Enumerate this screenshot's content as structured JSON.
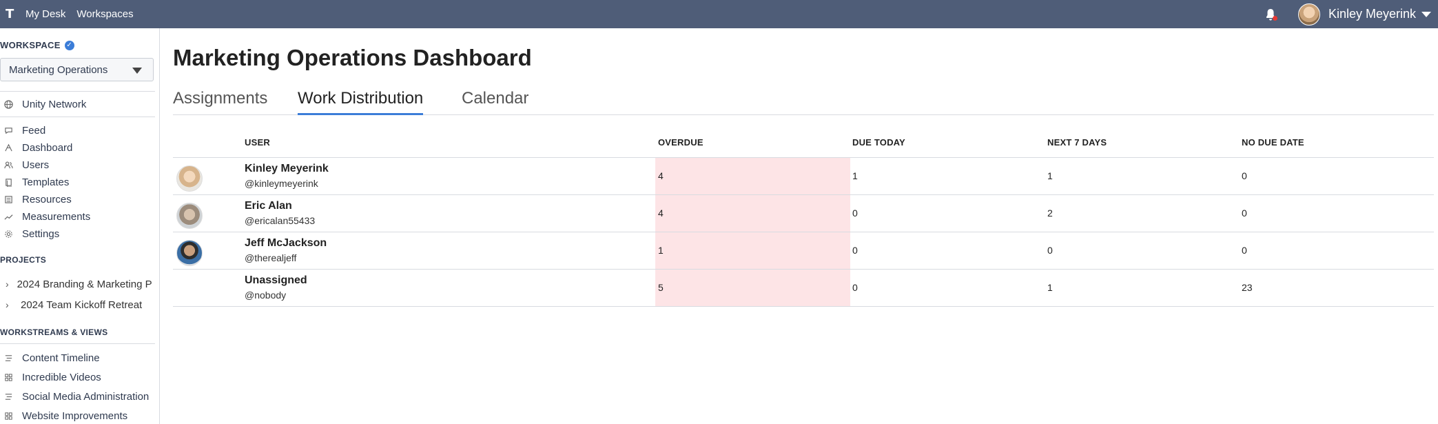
{
  "topbar": {
    "logo": "T",
    "nav": [
      "My Desk",
      "Workspaces"
    ],
    "username": "Kinley Meyerink"
  },
  "sidebar": {
    "workspace_label": "WORKSPACE",
    "workspace_selected": "Marketing Operations",
    "network": "Unity Network",
    "nav": [
      {
        "label": "Feed",
        "icon": "chat-bubble-icon"
      },
      {
        "label": "Dashboard",
        "icon": "dashboard-icon"
      },
      {
        "label": "Users",
        "icon": "users-icon"
      },
      {
        "label": "Templates",
        "icon": "templates-icon"
      },
      {
        "label": "Resources",
        "icon": "resources-icon"
      },
      {
        "label": "Measurements",
        "icon": "trend-icon"
      },
      {
        "label": "Settings",
        "icon": "gear-icon"
      }
    ],
    "projects_label": "PROJECTS",
    "projects": [
      "2024 Branding & Marketing P",
      "2024 Team Kickoff Retreat"
    ],
    "workstreams_label": "WORKSTREAMS & VIEWS",
    "workstreams": [
      {
        "label": "Content Timeline",
        "icon": "timeline-icon"
      },
      {
        "label": "Incredible Videos",
        "icon": "grid-icon"
      },
      {
        "label": "Social Media Administration",
        "icon": "timeline-icon"
      },
      {
        "label": "Website Improvements",
        "icon": "grid-icon"
      }
    ]
  },
  "main": {
    "title": "Marketing Operations Dashboard",
    "tabs": [
      "Assignments",
      "Work Distribution",
      "Calendar"
    ],
    "active_tab": "Work Distribution",
    "table": {
      "headers": [
        "USER",
        "OVERDUE",
        "DUE TODAY",
        "NEXT 7 DAYS",
        "NO DUE DATE"
      ],
      "rows": [
        {
          "name": "Kinley Meyerink",
          "handle": "@kinleymeyerink",
          "overdue": "4",
          "due_today": "1",
          "next7": "1",
          "no_due": "0"
        },
        {
          "name": "Eric Alan",
          "handle": "@ericalan55433",
          "overdue": "4",
          "due_today": "0",
          "next7": "2",
          "no_due": "0"
        },
        {
          "name": "Jeff McJackson",
          "handle": "@therealjeff",
          "overdue": "1",
          "due_today": "0",
          "next7": "0",
          "no_due": "0"
        },
        {
          "name": "Unassigned",
          "handle": "@nobody",
          "overdue": "5",
          "due_today": "0",
          "next7": "1",
          "no_due": "23"
        }
      ]
    }
  },
  "colors": {
    "topbar": "#4f5d78",
    "accent": "#3b7dd8",
    "overdue_highlight": "#fde4e6",
    "notification_dot": "#e53935"
  }
}
